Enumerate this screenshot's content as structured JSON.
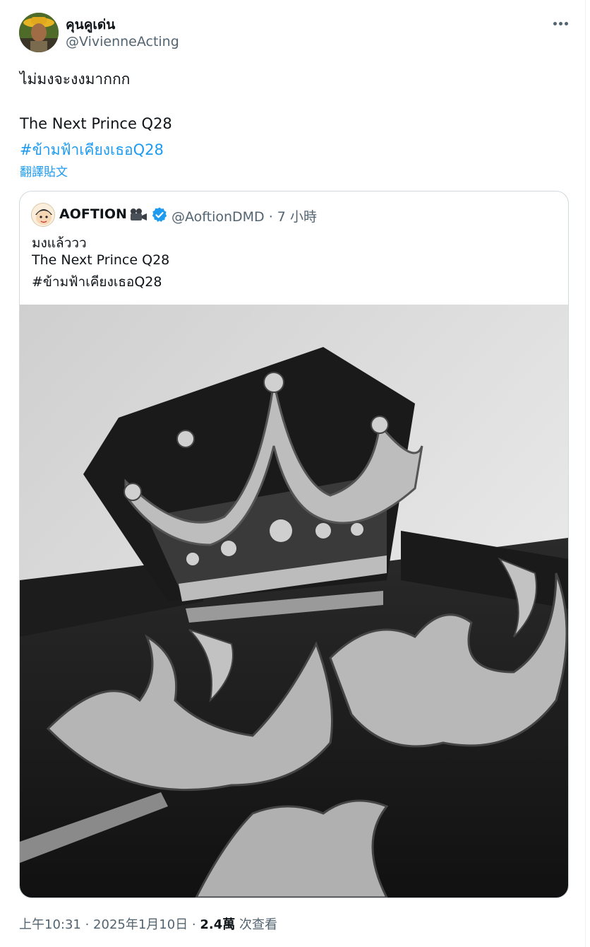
{
  "author": {
    "display_name": "คุนคูเด่น",
    "handle": "@VivienneActing"
  },
  "tweet": {
    "line1": "ไม่มงจะงงมากกก",
    "line2": "The Next Prince Q28",
    "hashtag": "#ข้ามฟ้าเคียงเธอQ28",
    "translate_link": "翻譯貼文"
  },
  "quote": {
    "display_name": "AOFTION",
    "handle_time": "@AoftionDMD · 7 小時",
    "line1": "มงแล้ววว",
    "line2": "The Next Prince Q28",
    "line3": "#ข้ามฟ้าเคียงเธอQ28",
    "media_description_icon": "crown-ornament-photo"
  },
  "meta": {
    "time_date": "上午10:31 · 2025年1月10日 · ",
    "views_count": "2.4萬",
    "views_label": " 次查看"
  },
  "icons": {
    "more": "more-dots-icon",
    "verified": "verified-badge-icon",
    "camera": "movie-camera-icon"
  },
  "colors": {
    "link": "#1d9bf0",
    "secondary_text": "#536471",
    "primary_text": "#0f1419",
    "border": "#cfd9de"
  }
}
